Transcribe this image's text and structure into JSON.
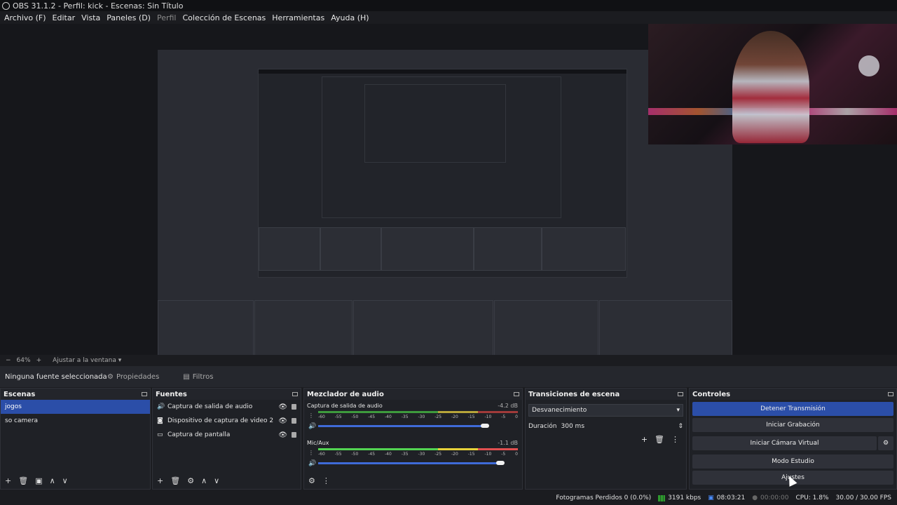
{
  "window": {
    "title": "OBS 31.1.2 - Perfil: kick - Escenas: Sin Título"
  },
  "menu": [
    {
      "label": "Archivo (F)",
      "enabled": true
    },
    {
      "label": "Editar",
      "enabled": true
    },
    {
      "label": "Vista",
      "enabled": true
    },
    {
      "label": "Paneles (D)",
      "enabled": true
    },
    {
      "label": "Perfil",
      "enabled": false
    },
    {
      "label": "Colección de Escenas",
      "enabled": true
    },
    {
      "label": "Herramientas",
      "enabled": true
    },
    {
      "label": "Ayuda (H)",
      "enabled": true
    }
  ],
  "zoom": {
    "minus": "−",
    "value": "64%",
    "plus": "+",
    "fit_label": "Ajustar a la ventana"
  },
  "source_bar": {
    "no_source": "Ninguna fuente seleccionada",
    "properties": "Propiedades",
    "filters": "Filtros"
  },
  "scenes": {
    "title": "Escenas",
    "items": [
      "jogos",
      "so camera"
    ],
    "selected": 0
  },
  "sources": {
    "title": "Fuentes",
    "items": [
      {
        "label": "Captura de salida de audio",
        "icon": "speaker-icon"
      },
      {
        "label": "Dispositivo de captura de video 2",
        "icon": "camera-icon"
      },
      {
        "label": "Captura de pantalla",
        "icon": "monitor-icon"
      }
    ]
  },
  "mixer": {
    "title": "Mezclador de audio",
    "channels": [
      {
        "name": "Captura de salida de audio",
        "db": "-4.2 dB",
        "volume": 0.85
      },
      {
        "name": "Mic/Aux",
        "db": "-1.1 dB",
        "volume": 0.93
      }
    ],
    "ticks": [
      "-60",
      "-55",
      "-50",
      "-45",
      "-40",
      "-35",
      "-30",
      "-25",
      "-20",
      "-15",
      "-10",
      "-5",
      "0"
    ]
  },
  "transitions": {
    "title": "Transiciones de escena",
    "selected": "Desvanecimiento",
    "duration_label": "Duración",
    "duration_value": "300 ms"
  },
  "controls": {
    "title": "Controles",
    "buttons": [
      "Detener Transmisión",
      "Iniciar Grabación",
      "Iniciar Cámara Virtual",
      "Modo Estudio",
      "Ajustes"
    ]
  },
  "status": {
    "dropped": "Fotogramas Perdidos 0 (0.0%)",
    "kbps": "3191 kbps",
    "stream_time": "08:03:21",
    "rec_time": "00:00:00",
    "cpu": "CPU: 1.8%",
    "fps": "30.00 / 30.00 FPS"
  }
}
